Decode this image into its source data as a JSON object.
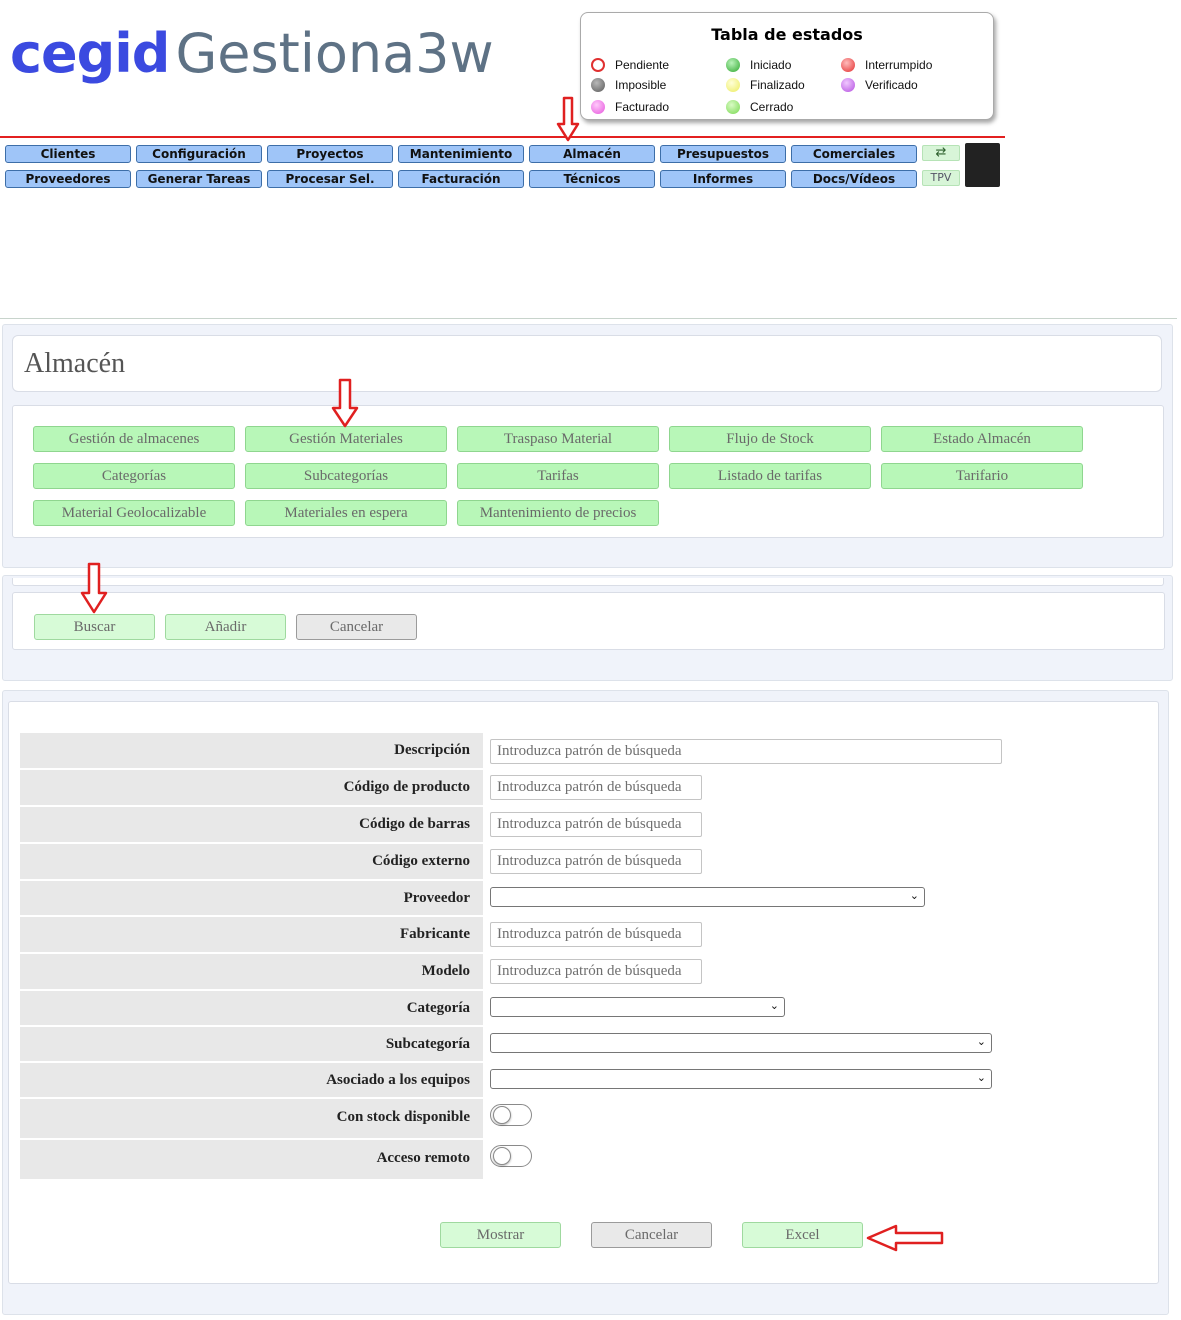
{
  "header": {
    "brand": "cegid",
    "product": "Gestiona3w"
  },
  "legend": {
    "title": "Tabla de estados",
    "items": [
      {
        "label": "Pendiente",
        "color": "#ffffff",
        "ring": "#e03030"
      },
      {
        "label": "Imposible",
        "color": "#7a7a7a"
      },
      {
        "label": "Facturado",
        "color": "#f07ae8"
      },
      {
        "label": "Iniciado",
        "color": "#3fbf3f"
      },
      {
        "label": "Finalizado",
        "color": "#f6f680"
      },
      {
        "label": "Cerrado",
        "color": "#8fe36a"
      },
      {
        "label": "Interrumpido",
        "color": "#f04848"
      },
      {
        "label": "Verificado",
        "color": "#c87ae8"
      }
    ]
  },
  "nav": {
    "row1": [
      "Clientes",
      "Configuración",
      "Proyectos",
      "Mantenimiento",
      "Almacén",
      "Presupuestos",
      "Comerciales"
    ],
    "row2": [
      "Proveedores",
      "Generar Tareas",
      "Procesar Sel.",
      "Facturación",
      "Técnicos",
      "Informes",
      "Docs/Vídeos"
    ],
    "swap_icon": "⇄",
    "tpv": "TPV"
  },
  "section": {
    "title": "Almacén",
    "menu": [
      "Gestión de almacenes",
      "Gestión Materiales",
      "Traspaso Material",
      "Flujo de Stock",
      "Estado Almacén",
      "Categorías",
      "Subcategorías",
      "Tarifas",
      "Listado de tarifas",
      "Tarifario",
      "Material Geolocalizable",
      "Materiales en espera",
      "Mantenimiento de precios"
    ]
  },
  "toolbar": {
    "search": "Buscar",
    "add": "Añadir",
    "cancel": "Cancelar"
  },
  "form": {
    "placeholder": "Introduzca patrón de búsqueda",
    "labels": {
      "descripcion": "Descripción",
      "codigo_producto": "Código de producto",
      "codigo_barras": "Código de barras",
      "codigo_externo": "Código externo",
      "proveedor": "Proveedor",
      "fabricante": "Fabricante",
      "modelo": "Modelo",
      "categoria": "Categoría",
      "subcategoria": "Subcategoría",
      "asociado": "Asociado a los equipos",
      "con_stock": "Con stock disponible",
      "acceso_remoto": "Acceso remoto"
    },
    "toggles": {
      "con_stock": false,
      "acceso_remoto": false
    }
  },
  "footer_buttons": {
    "show": "Mostrar",
    "cancel": "Cancelar",
    "excel": "Excel"
  }
}
